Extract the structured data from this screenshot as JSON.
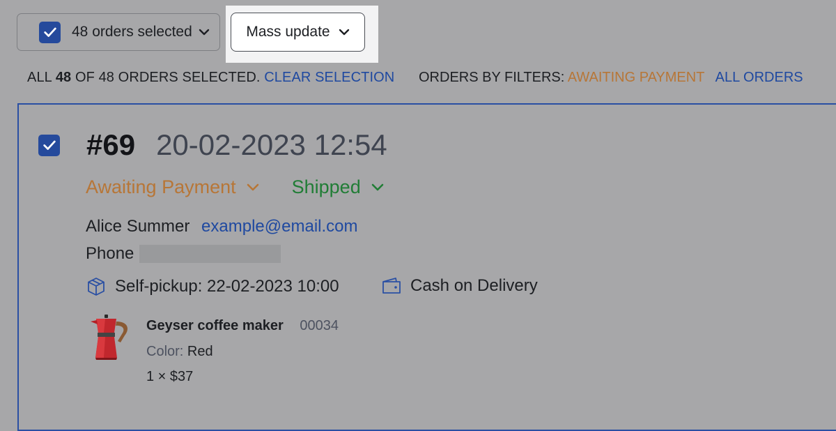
{
  "toolbar": {
    "selected_label": "48 orders selected",
    "mass_update_label": "Mass update"
  },
  "selection_info": {
    "prefix": "ALL",
    "count": "48",
    "suffix": "OF 48 ORDERS SELECTED.",
    "clear_label": "CLEAR SELECTION"
  },
  "filters": {
    "label": "ORDERS BY FILTERS:",
    "awaiting_payment": "AWAITING PAYMENT",
    "all_orders": "ALL ORDERS"
  },
  "order": {
    "number": "#69",
    "date": "20-02-2023 12:54",
    "payment_status": "Awaiting Payment",
    "fulfillment_status": "Shipped",
    "customer_name": "Alice Summer",
    "customer_email": "example@email.com",
    "phone_label": "Phone",
    "delivery": "Self-pickup: 22-02-2023 10:00",
    "payment_method": "Cash on Delivery",
    "item": {
      "name": "Geyser coffee maker",
      "sku": "00034",
      "color_label": "Color:",
      "color_value": "Red",
      "quantity_price": "1 × $37"
    }
  },
  "colors": {
    "accent_blue": "#254a9c",
    "status_orange": "#b77637",
    "status_green": "#217d36"
  },
  "icons": {
    "checkbox": "check-icon",
    "dropdown": "chevron-down-icon",
    "delivery": "package-icon",
    "payment": "wallet-icon"
  }
}
